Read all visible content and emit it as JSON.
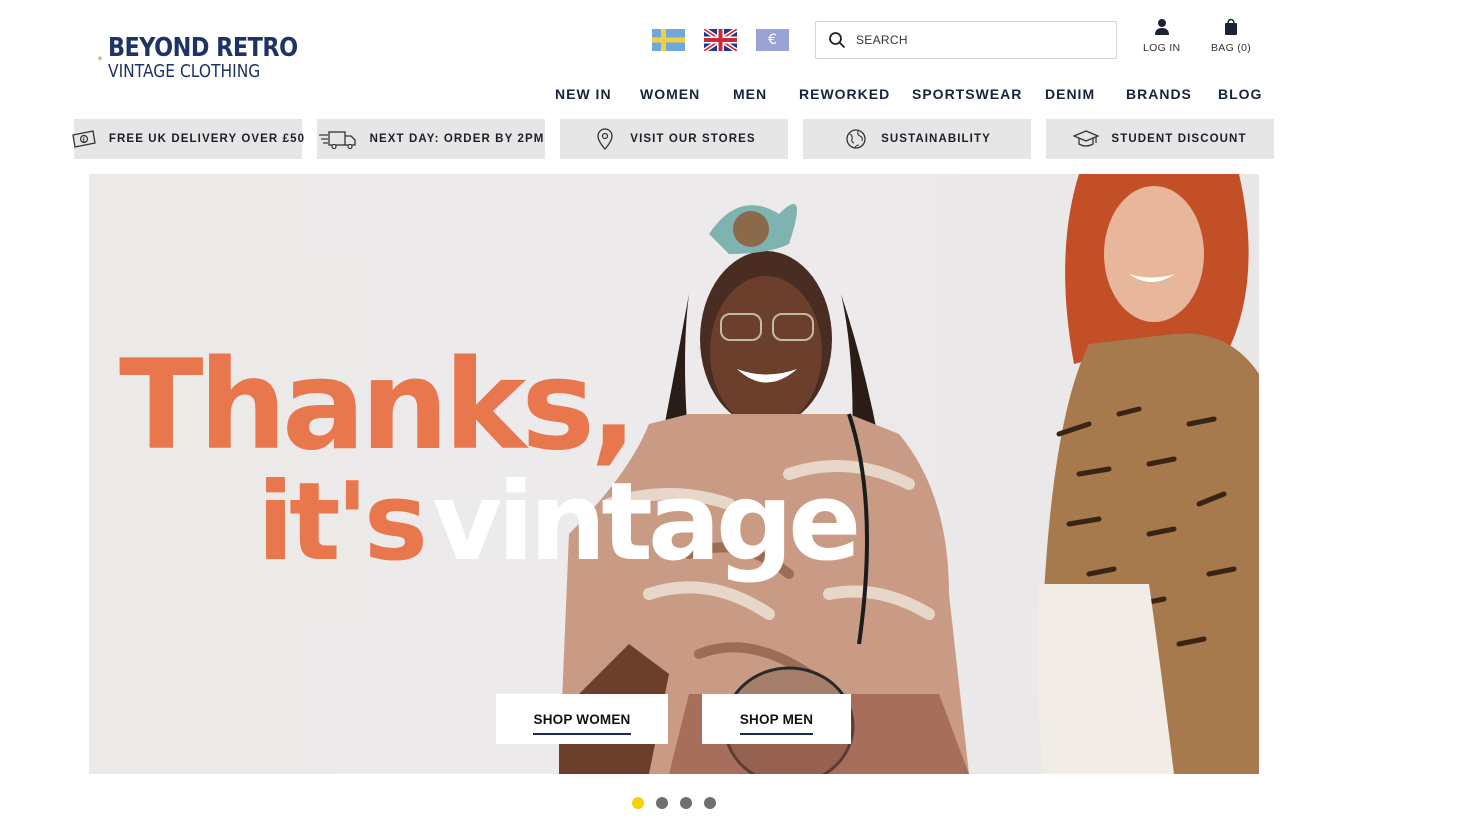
{
  "brand": {
    "line1": "BEYOND RETRO",
    "line2": "VINTAGE CLOTHING",
    "primary_color": "#1f3266",
    "accent_color": "#c9a235"
  },
  "header": {
    "flags": [
      {
        "name": "sweden-flag",
        "colors": [
          "#6fa9dc",
          "#f0d144"
        ]
      },
      {
        "name": "uk-flag",
        "colors": [
          "#23358f",
          "#ffffff",
          "#cc2936"
        ]
      },
      {
        "name": "euro-flag",
        "label": "€",
        "colors": [
          "#9aa3d6"
        ]
      }
    ],
    "search": {
      "placeholder": "SEARCH",
      "icon": "search-icon"
    },
    "login_label": "LOG IN",
    "bag_label": "BAG (0)"
  },
  "nav": {
    "items": [
      "NEW IN",
      "WOMEN",
      "MEN",
      "REWORKED",
      "SPORTSWEAR",
      "DENIM",
      "BRANDS",
      "BLOG"
    ]
  },
  "usp": [
    {
      "label": "FREE UK DELIVERY OVER £50",
      "icon": "banknote-icon"
    },
    {
      "label": "NEXT DAY: ORDER BY 2PM",
      "icon": "delivery-truck-icon"
    },
    {
      "label": "VISIT OUR STORES",
      "icon": "location-pin-icon"
    },
    {
      "label": "SUSTAINABILITY",
      "icon": "globe-icon"
    },
    {
      "label": "STUDENT DISCOUNT",
      "icon": "graduation-cap-icon"
    }
  ],
  "hero": {
    "headline_line1": "Thanks,",
    "headline_line2_part1": "it's",
    "headline_line2_part2": "vintage",
    "headline_color": "#e8774e",
    "buttons": {
      "shop_women": "SHOP WOMEN",
      "shop_men": "SHOP MEN"
    }
  },
  "carousel": {
    "slides": 4,
    "active_index": 0,
    "active_color": "#f4d300"
  }
}
